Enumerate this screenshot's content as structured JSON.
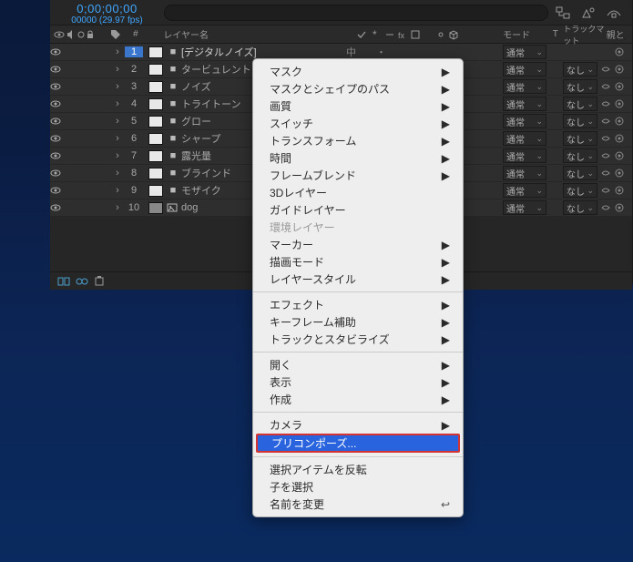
{
  "timecode": {
    "main": "0;00;00;00",
    "sub": "00000 (29.97 fps)"
  },
  "search": {
    "placeholder": ""
  },
  "columns": {
    "number": "#",
    "layer_name": "レイヤー名",
    "mode": "モード",
    "t": "T",
    "track_matte": "トラックマット",
    "parent": "親と"
  },
  "layers": [
    {
      "num": 1,
      "color": "sw-white",
      "name": "[デジタルノイズ]",
      "mode": "通常",
      "trk": "",
      "selected": true
    },
    {
      "num": 2,
      "color": "sw-white",
      "name": "タービュレント",
      "mode": "通常",
      "trk": "なし",
      "selected": false
    },
    {
      "num": 3,
      "color": "sw-white",
      "name": "ノイズ",
      "mode": "通常",
      "trk": "なし",
      "selected": false
    },
    {
      "num": 4,
      "color": "sw-white",
      "name": "トライトーン",
      "mode": "通常",
      "trk": "なし",
      "selected": false
    },
    {
      "num": 5,
      "color": "sw-white",
      "name": "グロー",
      "mode": "通常",
      "trk": "なし",
      "selected": false
    },
    {
      "num": 6,
      "color": "sw-white",
      "name": "シャープ",
      "mode": "通常",
      "trk": "なし",
      "selected": false
    },
    {
      "num": 7,
      "color": "sw-white",
      "name": "露光量",
      "mode": "通常",
      "trk": "なし",
      "selected": false
    },
    {
      "num": 8,
      "color": "sw-white",
      "name": "ブラインド",
      "mode": "通常",
      "trk": "なし",
      "selected": false
    },
    {
      "num": 9,
      "color": "sw-white",
      "name": "モザイク",
      "mode": "通常",
      "trk": "なし",
      "selected": false
    },
    {
      "num": 10,
      "color": "sw-gray",
      "name": "dog",
      "mode": "通常",
      "trk": "なし",
      "selected": false,
      "img": true
    }
  ],
  "ctx": {
    "mask": "マスク",
    "mask_shape": "マスクとシェイプのパス",
    "quality": "画質",
    "switches": "スイッチ",
    "transform": "トランスフォーム",
    "time": "時間",
    "frame_blend": "フレームブレンド",
    "layer3d": "3Dレイヤー",
    "guide": "ガイドレイヤー",
    "env": "環境レイヤー",
    "marker": "マーカー",
    "blend_mode": "描画モード",
    "layer_style": "レイヤースタイル",
    "effect": "エフェクト",
    "kf_assist": "キーフレーム補助",
    "track_stab": "トラックとスタビライズ",
    "open": "開く",
    "reveal": "表示",
    "create": "作成",
    "camera": "カメラ",
    "precompose": "プリコンポーズ...",
    "invert_sel": "選択アイテムを反転",
    "sel_children": "子を選択",
    "rename": "名前を変更"
  }
}
